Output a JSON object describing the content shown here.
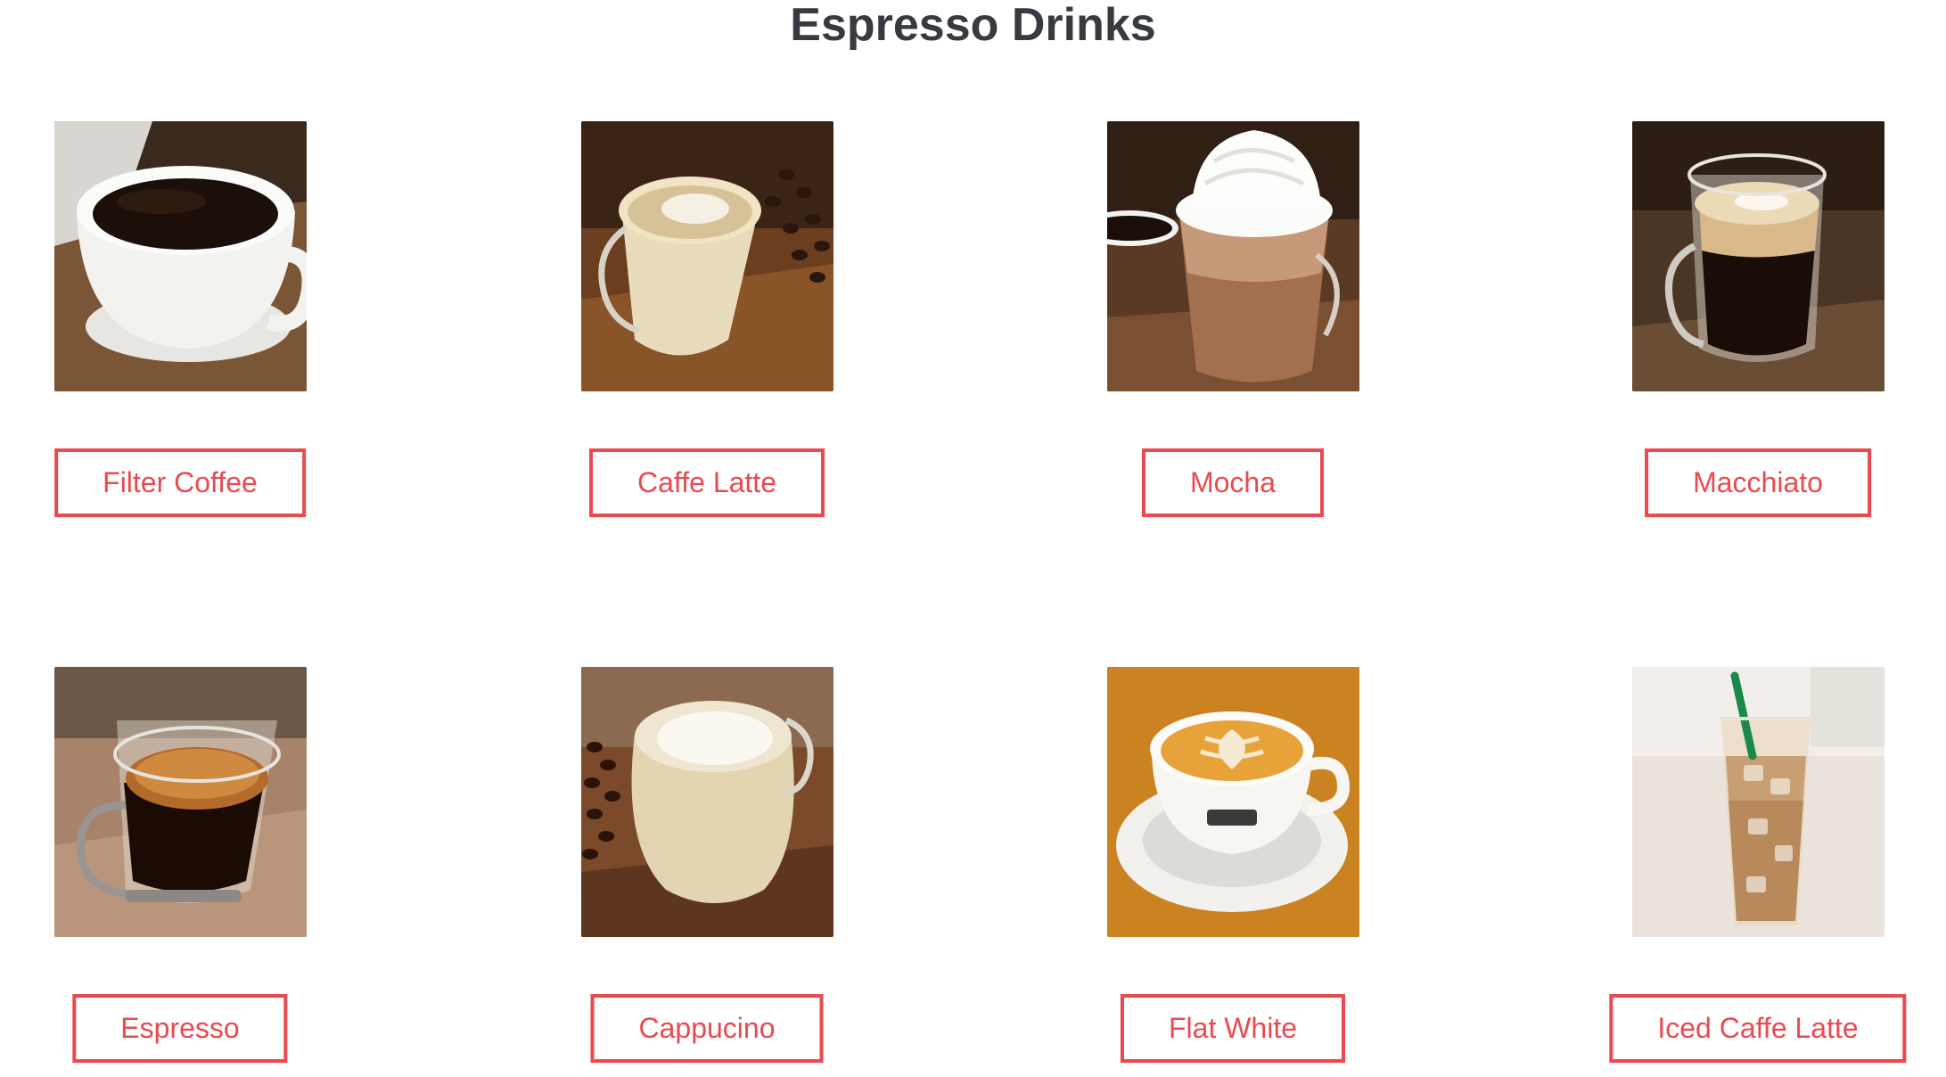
{
  "page": {
    "title": "Espresso Drinks"
  },
  "colors": {
    "accent": "#ea4a4f",
    "title": "#373a41",
    "background": "#ffffff"
  },
  "drinks": [
    {
      "name": "Filter Coffee",
      "image": "filter-coffee-photo"
    },
    {
      "name": "Caffe Latte",
      "image": "caffe-latte-photo"
    },
    {
      "name": "Mocha",
      "image": "mocha-photo"
    },
    {
      "name": "Macchiato",
      "image": "macchiato-photo"
    },
    {
      "name": "Espresso",
      "image": "espresso-photo"
    },
    {
      "name": "Cappucino",
      "image": "cappucino-photo"
    },
    {
      "name": "Flat White",
      "image": "flat-white-photo"
    },
    {
      "name": "Iced Caffe Latte",
      "image": "iced-caffe-latte-photo"
    }
  ]
}
